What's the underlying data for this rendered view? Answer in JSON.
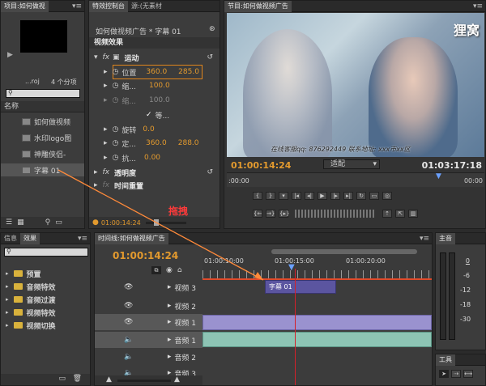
{
  "project": {
    "tab": "项目:如何做视",
    "item_count": "4 个分项",
    "bin_name": "...roj",
    "col_name": "名称",
    "items": [
      "如何做视频",
      "水印logo图",
      "神雕侠侣-",
      "字幕 01"
    ]
  },
  "effect_controls": {
    "tab_active": "特效控制台",
    "tab_other": "源:(无素材",
    "sequence_label": "如何做视频广告 * 字幕 01",
    "section_video": "视频效果",
    "motion": "运动",
    "position_label": "位置",
    "position_x": "360.0",
    "position_y": "285.0",
    "scale_label": "缩...",
    "scale_value": "100.0",
    "scale_w_label": "缩...",
    "scale_w_value": "100.0",
    "uniform_label": "等...",
    "rotation_label": "旋转",
    "rotation_value": "0.0",
    "anchor_label": "定...",
    "anchor_x": "360.0",
    "anchor_y": "288.0",
    "flicker_label": "抗...",
    "flicker_value": "0.00",
    "opacity_label": "透明度",
    "time_remap_label": "时间重置",
    "timecode": "01:00:14:24"
  },
  "program": {
    "tab": "节目:如何做视频广告",
    "watermark": "狸窝",
    "subtitle_overlay": "在线客服qq: 876292449  联系地址: xxx市xx区",
    "timecode_current": "01:00:14:24",
    "fit_select": "适配",
    "timecode_duration": "01:03:17:18",
    "ruler_start": ":00:00",
    "ruler_end": "00:00"
  },
  "effects_panel": {
    "tab_info": "信息",
    "tab_effects": "效果",
    "folders": [
      "预置",
      "音频特效",
      "音频过渡",
      "视频特效",
      "视频切换"
    ]
  },
  "timeline": {
    "tab": "时间线:如何做视频广告",
    "timecode": "01:00:14:24",
    "ruler_labels": [
      "01:00:10:00",
      "01:00:15:00",
      "01:00:20:00"
    ],
    "tracks": [
      "视频 3",
      "视频 2",
      "视频 1",
      "音频 1",
      "音频 2",
      "音频 3"
    ],
    "clip_name": "字幕 01",
    "drag_annotation": "拖拽"
  },
  "master": {
    "tab": "主音",
    "scale": [
      "0",
      "-6",
      "-12",
      "-18",
      "-30"
    ]
  },
  "tools": {
    "tab": "工具"
  }
}
